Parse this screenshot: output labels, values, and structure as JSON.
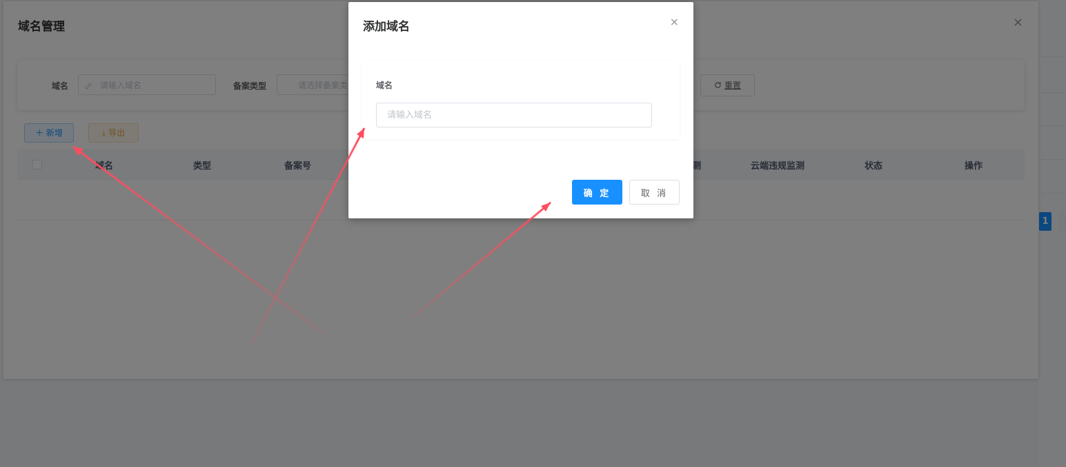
{
  "main_dialog": {
    "title": "域名管理",
    "close_icon": "×",
    "search": {
      "domain_label": "域名",
      "domain_placeholder": "请输入域名",
      "record_type_label": "备案类型",
      "record_type_placeholder": "请选择备案类",
      "reset_label": "重置"
    },
    "toolbar": {
      "add_label": "新增",
      "export_label": "导出"
    },
    "table_headers": [
      "域名",
      "类型",
      "备案号",
      "测",
      "云端违规监测",
      "状态",
      "操作"
    ],
    "pagination_current": "1"
  },
  "add_dialog": {
    "title": "添加域名",
    "close_icon": "×",
    "field_label": "域名",
    "field_placeholder": "请输入域名",
    "field_value": "",
    "confirm_label": "确 定",
    "cancel_label": "取 消"
  },
  "colors": {
    "primary": "#1890ff",
    "warning": "#e6a23c",
    "annotation_arrow": "#ff4d5e"
  },
  "icons": {
    "link": "link-icon",
    "refresh": "refresh-icon",
    "plus": "plus-icon",
    "download": "download-icon",
    "close": "close-icon"
  }
}
